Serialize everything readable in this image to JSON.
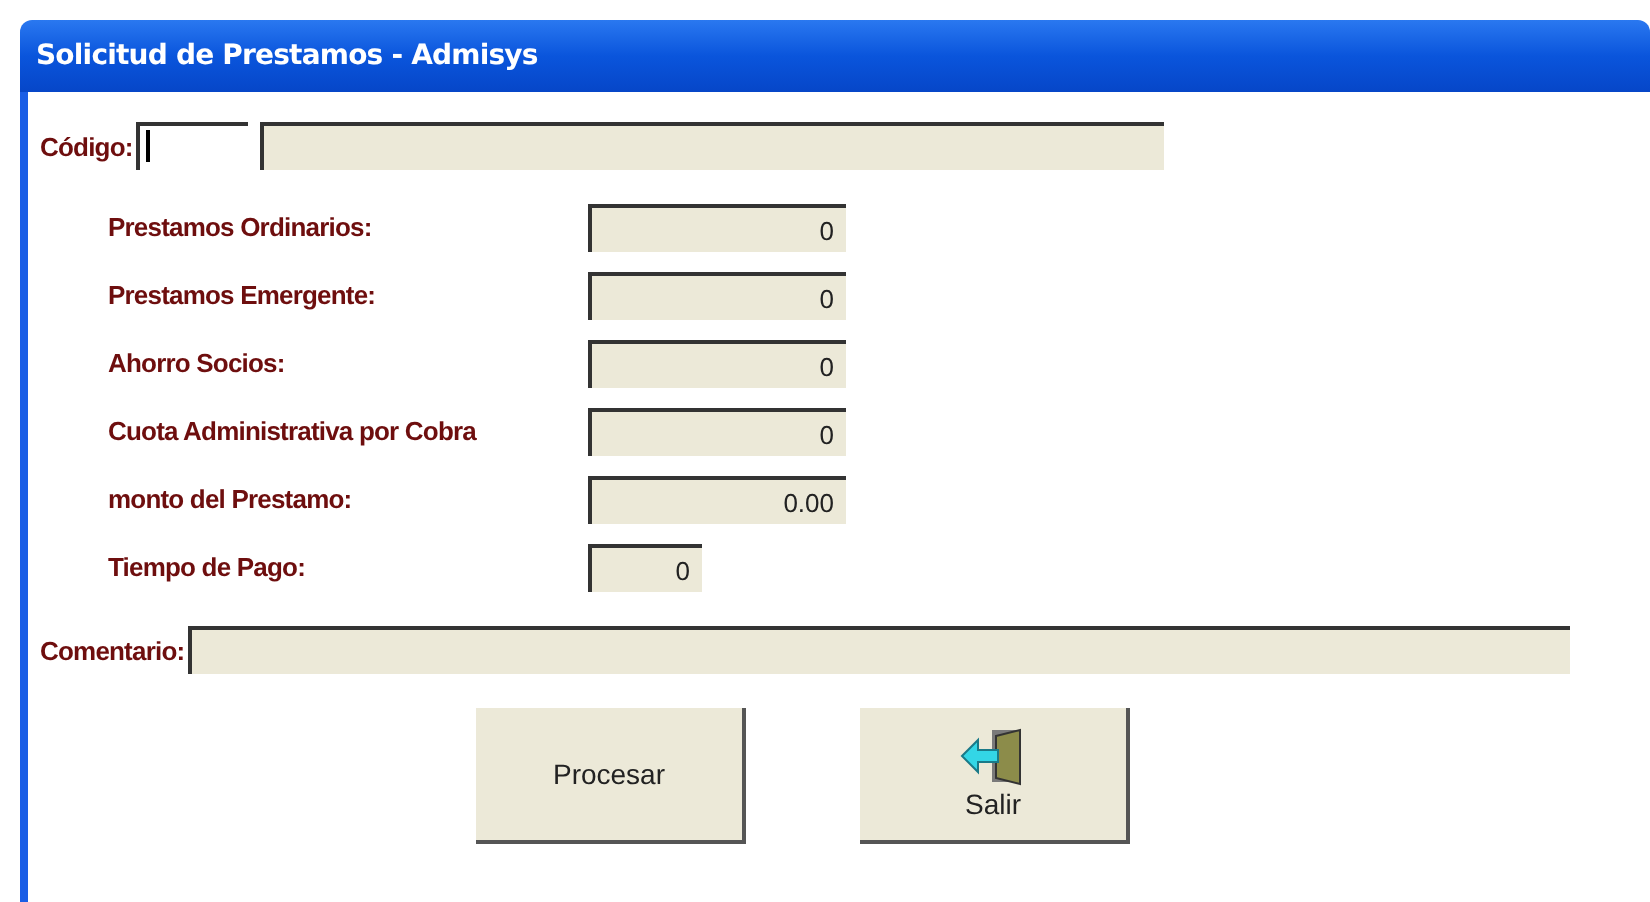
{
  "window": {
    "title": "Solicitud de Prestamos - Admisys"
  },
  "code": {
    "label": "Código:",
    "focused": true
  },
  "rows": [
    {
      "label": "Prestamos Ordinarios:",
      "value": "0",
      "kind": "wide"
    },
    {
      "label": "Prestamos Emergente:",
      "value": "0",
      "kind": "wide"
    },
    {
      "label": "Ahorro Socios:",
      "value": "0",
      "kind": "wide"
    },
    {
      "label": "Cuota Administrativa por Cobra",
      "value": "0",
      "kind": "wide"
    },
    {
      "label": "monto del Prestamo:",
      "value": "0.00",
      "kind": "wide"
    },
    {
      "label": "Tiempo de Pago:",
      "value": "0",
      "kind": "narrow"
    }
  ],
  "comment": {
    "label": "Comentario:"
  },
  "buttons": [
    {
      "label": "Procesar",
      "kind": "text"
    },
    {
      "label": "Salir",
      "kind": "exit"
    }
  ]
}
